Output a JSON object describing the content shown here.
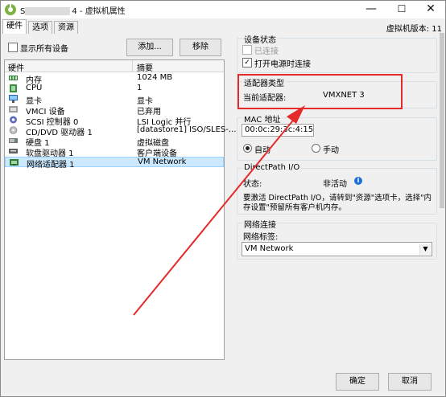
{
  "window": {
    "title_prefix": "S",
    "title": "4 - 虚拟机属性",
    "min": "—",
    "max": "☐",
    "close": "✕"
  },
  "tabs": [
    {
      "label": "硬件"
    },
    {
      "label": "选项"
    },
    {
      "label": "资源"
    }
  ],
  "version": "虚拟机版本: 11",
  "hardware": {
    "show_all_label": "显示所有设备",
    "add_label": "添加...",
    "remove_label": "移除",
    "col_hardware": "硬件",
    "col_summary": "摘要",
    "rows": [
      {
        "name": "内存",
        "summary": "1024 MB",
        "icon": "memory-icon"
      },
      {
        "name": "CPU",
        "summary": "1",
        "icon": "cpu-icon"
      },
      {
        "name": "显卡",
        "summary": "显卡",
        "icon": "video-card-icon"
      },
      {
        "name": "VMCI 设备",
        "summary": "已弃用",
        "icon": "vmci-icon"
      },
      {
        "name": "SCSI 控制器 0",
        "summary": "LSI Logic 并行",
        "icon": "scsi-icon"
      },
      {
        "name": "CD/DVD 驱动器 1",
        "summary": "[datastore1] ISO/SLES-...",
        "icon": "cd-icon"
      },
      {
        "name": "硬盘 1",
        "summary": "虚拟磁盘",
        "icon": "hard-disk-icon"
      },
      {
        "name": "软盘驱动器 1",
        "summary": "客户端设备",
        "icon": "floppy-icon"
      },
      {
        "name": "网络适配器 1",
        "summary": "VM Network",
        "icon": "network-adapter-icon"
      }
    ]
  },
  "device_status": {
    "title": "设备状态",
    "connected": "已连接",
    "connect_on_power": "打开电源时连接"
  },
  "adapter_type": {
    "title": "适配器类型",
    "current_label": "当前适配器:",
    "current_value": "VMXNET 3"
  },
  "mac": {
    "title": "MAC 地址",
    "value": "00:0c:29:3c:4:15",
    "auto": "自动",
    "manual": "手动"
  },
  "directpath": {
    "title": "DirectPath I/O",
    "status_label": "状态:",
    "status_value": "非活动",
    "desc1": "要激活 DirectPath I/O，请转到\"资源\"选项卡，选择\"内",
    "desc2": "存设置\"预留所有客户机内存。"
  },
  "network": {
    "title": "网络连接",
    "label": "网络标签:",
    "value": "VM Network"
  },
  "footer": {
    "ok": "确定",
    "cancel": "取消"
  },
  "colors": {
    "highlight": "#e52a2a",
    "selection": "#cce8ff"
  }
}
